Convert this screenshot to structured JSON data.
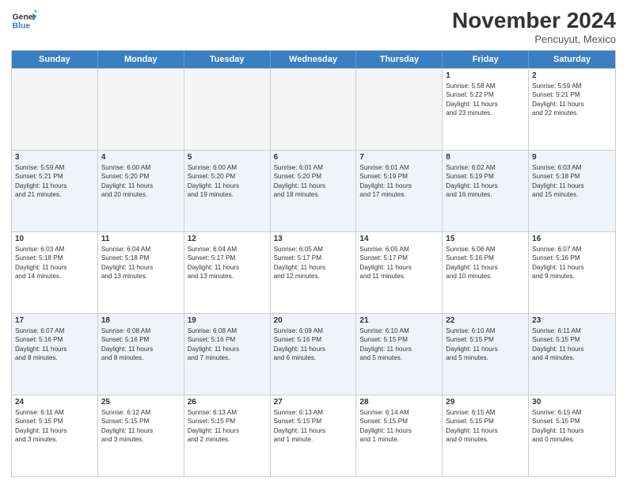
{
  "logo": {
    "line1": "General",
    "line2": "Blue"
  },
  "title": "November 2024",
  "subtitle": "Pencuyut, Mexico",
  "header_days": [
    "Sunday",
    "Monday",
    "Tuesday",
    "Wednesday",
    "Thursday",
    "Friday",
    "Saturday"
  ],
  "rows": [
    [
      {
        "day": "",
        "info": "",
        "empty": true
      },
      {
        "day": "",
        "info": "",
        "empty": true
      },
      {
        "day": "",
        "info": "",
        "empty": true
      },
      {
        "day": "",
        "info": "",
        "empty": true
      },
      {
        "day": "",
        "info": "",
        "empty": true
      },
      {
        "day": "1",
        "info": "Sunrise: 5:58 AM\nSunset: 5:22 PM\nDaylight: 11 hours\nand 23 minutes.",
        "empty": false
      },
      {
        "day": "2",
        "info": "Sunrise: 5:59 AM\nSunset: 5:21 PM\nDaylight: 11 hours\nand 22 minutes.",
        "empty": false
      }
    ],
    [
      {
        "day": "3",
        "info": "Sunrise: 5:59 AM\nSunset: 5:21 PM\nDaylight: 11 hours\nand 21 minutes.",
        "empty": false
      },
      {
        "day": "4",
        "info": "Sunrise: 6:00 AM\nSunset: 5:20 PM\nDaylight: 11 hours\nand 20 minutes.",
        "empty": false
      },
      {
        "day": "5",
        "info": "Sunrise: 6:00 AM\nSunset: 5:20 PM\nDaylight: 11 hours\nand 19 minutes.",
        "empty": false
      },
      {
        "day": "6",
        "info": "Sunrise: 6:01 AM\nSunset: 5:20 PM\nDaylight: 11 hours\nand 18 minutes.",
        "empty": false
      },
      {
        "day": "7",
        "info": "Sunrise: 6:01 AM\nSunset: 5:19 PM\nDaylight: 11 hours\nand 17 minutes.",
        "empty": false
      },
      {
        "day": "8",
        "info": "Sunrise: 6:02 AM\nSunset: 5:19 PM\nDaylight: 11 hours\nand 16 minutes.",
        "empty": false
      },
      {
        "day": "9",
        "info": "Sunrise: 6:03 AM\nSunset: 5:18 PM\nDaylight: 11 hours\nand 15 minutes.",
        "empty": false
      }
    ],
    [
      {
        "day": "10",
        "info": "Sunrise: 6:03 AM\nSunset: 5:18 PM\nDaylight: 11 hours\nand 14 minutes.",
        "empty": false
      },
      {
        "day": "11",
        "info": "Sunrise: 6:04 AM\nSunset: 5:18 PM\nDaylight: 11 hours\nand 13 minutes.",
        "empty": false
      },
      {
        "day": "12",
        "info": "Sunrise: 6:04 AM\nSunset: 5:17 PM\nDaylight: 11 hours\nand 13 minutes.",
        "empty": false
      },
      {
        "day": "13",
        "info": "Sunrise: 6:05 AM\nSunset: 5:17 PM\nDaylight: 11 hours\nand 12 minutes.",
        "empty": false
      },
      {
        "day": "14",
        "info": "Sunrise: 6:05 AM\nSunset: 5:17 PM\nDaylight: 11 hours\nand 11 minutes.",
        "empty": false
      },
      {
        "day": "15",
        "info": "Sunrise: 6:06 AM\nSunset: 5:16 PM\nDaylight: 11 hours\nand 10 minutes.",
        "empty": false
      },
      {
        "day": "16",
        "info": "Sunrise: 6:07 AM\nSunset: 5:16 PM\nDaylight: 11 hours\nand 9 minutes.",
        "empty": false
      }
    ],
    [
      {
        "day": "17",
        "info": "Sunrise: 6:07 AM\nSunset: 5:16 PM\nDaylight: 11 hours\nand 8 minutes.",
        "empty": false
      },
      {
        "day": "18",
        "info": "Sunrise: 6:08 AM\nSunset: 5:16 PM\nDaylight: 11 hours\nand 8 minutes.",
        "empty": false
      },
      {
        "day": "19",
        "info": "Sunrise: 6:08 AM\nSunset: 5:16 PM\nDaylight: 11 hours\nand 7 minutes.",
        "empty": false
      },
      {
        "day": "20",
        "info": "Sunrise: 6:09 AM\nSunset: 5:16 PM\nDaylight: 11 hours\nand 6 minutes.",
        "empty": false
      },
      {
        "day": "21",
        "info": "Sunrise: 6:10 AM\nSunset: 5:15 PM\nDaylight: 11 hours\nand 5 minutes.",
        "empty": false
      },
      {
        "day": "22",
        "info": "Sunrise: 6:10 AM\nSunset: 5:15 PM\nDaylight: 11 hours\nand 5 minutes.",
        "empty": false
      },
      {
        "day": "23",
        "info": "Sunrise: 6:11 AM\nSunset: 5:15 PM\nDaylight: 11 hours\nand 4 minutes.",
        "empty": false
      }
    ],
    [
      {
        "day": "24",
        "info": "Sunrise: 6:11 AM\nSunset: 5:15 PM\nDaylight: 11 hours\nand 3 minutes.",
        "empty": false
      },
      {
        "day": "25",
        "info": "Sunrise: 6:12 AM\nSunset: 5:15 PM\nDaylight: 11 hours\nand 3 minutes.",
        "empty": false
      },
      {
        "day": "26",
        "info": "Sunrise: 6:13 AM\nSunset: 5:15 PM\nDaylight: 11 hours\nand 2 minutes.",
        "empty": false
      },
      {
        "day": "27",
        "info": "Sunrise: 6:13 AM\nSunset: 5:15 PM\nDaylight: 11 hours\nand 1 minute.",
        "empty": false
      },
      {
        "day": "28",
        "info": "Sunrise: 6:14 AM\nSunset: 5:15 PM\nDaylight: 11 hours\nand 1 minute.",
        "empty": false
      },
      {
        "day": "29",
        "info": "Sunrise: 6:15 AM\nSunset: 5:15 PM\nDaylight: 11 hours\nand 0 minutes.",
        "empty": false
      },
      {
        "day": "30",
        "info": "Sunrise: 6:15 AM\nSunset: 5:15 PM\nDaylight: 11 hours\nand 0 minutes.",
        "empty": false
      }
    ]
  ]
}
